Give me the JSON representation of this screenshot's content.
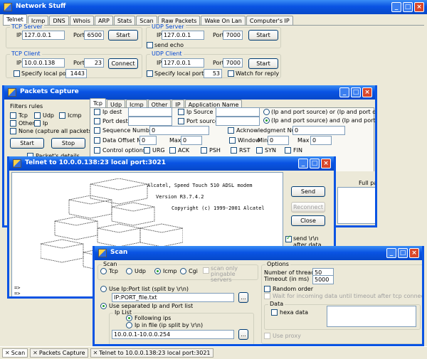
{
  "main": {
    "title": "Network Stuff",
    "tabs": [
      "Telnet",
      "Icmp",
      "DNS",
      "Whois",
      "ARP",
      "Stats",
      "Scan",
      "Raw Packets",
      "Wake On Lan",
      "Computer's IP"
    ],
    "tcp_server": {
      "legend": "TCP Server",
      "ip_label": "IP",
      "ip": "127.0.0.1",
      "port_label": "Port",
      "port": "6500",
      "button": "Start"
    },
    "udp_server": {
      "legend": "UDP Server",
      "ip_label": "IP",
      "ip": "127.0.0.1",
      "port_label": "Port",
      "port": "7000",
      "button": "Start",
      "send_echo": "send echo"
    },
    "tcp_client": {
      "legend": "TCP Client",
      "ip_label": "IP",
      "ip": "10.0.0.138",
      "port_label": "Port",
      "port": "23",
      "button": "Connect",
      "specify_local": "Specify local port",
      "local_port": "1443"
    },
    "udp_client": {
      "legend": "UDP Client",
      "ip_label": "IP",
      "ip": "127.0.0.1",
      "port_label": "Port",
      "port": "7000",
      "button": "Start",
      "specify_local": "Specify local port",
      "local_port": "53",
      "watch": "Watch for reply"
    }
  },
  "packets": {
    "title": "Packets Capture",
    "filters_label": "Filters rules",
    "filters": {
      "tcp": "Tcp",
      "udp": "Udp",
      "icmp": "Icmp",
      "other": "Other",
      "ip": "Ip",
      "none": "None (capture all packets)"
    },
    "start": "Start",
    "stop": "Stop",
    "details": "Packet's details",
    "tabs": [
      "Tcp",
      "Udp",
      "Icmp",
      "Other",
      "IP",
      "Application Name"
    ],
    "ip_dest": "Ip dest",
    "ip_source": "Ip Source",
    "port_dest": "Port dest",
    "port_source": "Port source",
    "radio1": "(Ip and port source) or (Ip and port dest)",
    "radio2": "(Ip and port source) and (Ip and port dest)",
    "seq": "Sequence Number",
    "seq_val": "0",
    "ack": "Acknowledgment Number",
    "ack_val": "0",
    "data_offset": "Data Offset Min",
    "do_min": "0",
    "max": "Max",
    "do_max": "0",
    "window": "Window",
    "min": "Min",
    "w_min": "0",
    "w_max": "0",
    "control": "Control options",
    "flags": [
      "URG",
      "ACK",
      "PSH",
      "RST",
      "SYN",
      "FIN"
    ],
    "full_packet": "Full packet"
  },
  "telnet": {
    "title": "Telnet to 10.0.0.138:23 local port:3021",
    "banner1": "Alcatel, Speed Touch 510 ADSL modem",
    "banner2": "Version R3.7.4.2",
    "banner3": "Copyright (c) 1999-2001 Alcatel",
    "prompt1": "=>",
    "prompt2": "=>",
    "send": "Send",
    "reconnect": "Reconnect",
    "close": "Close",
    "send_rn": "send \\r\\n after data"
  },
  "scan": {
    "title": "Scan",
    "scan_label": "Scan",
    "tcp": "Tcp",
    "udp": "Udp",
    "icmp": "Icmp",
    "cgi": "Cgi",
    "pingable": "scan only pingable servers",
    "use_list": "Use Ip:Port list (split by \\r\\n)",
    "list_file": "IP:PORT_file.txt",
    "use_sep": "Use separated  Ip and Port list",
    "ip_list": "Ip List",
    "following": "Following ips",
    "in_file": "Ip in file (ip split by \\r\\n)",
    "range": "10.0.0.1-10.0.0.254",
    "browse": "...",
    "options": "Options",
    "threads_label": "Number of threads :",
    "threads": "50",
    "timeout_label": "Timeout (in ms)",
    "timeout": "5000",
    "random": "Random order",
    "wait": "Wait for incoming data until timeout after tcp connect",
    "data": "Data",
    "hexa": "hexa data",
    "proxy": "Use proxy"
  },
  "taskbar": {
    "items": [
      "Scan",
      "Packets Capture",
      "Telnet to 10.0.0.138:23 local port:3021"
    ]
  }
}
